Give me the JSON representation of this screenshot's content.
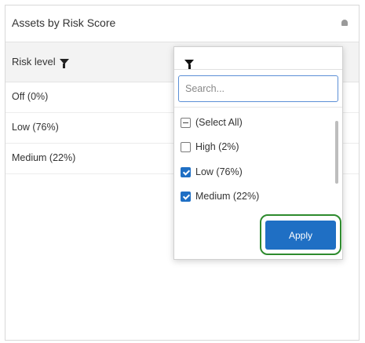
{
  "panel": {
    "title": "Assets by Risk Score"
  },
  "table": {
    "column_header": "Risk level",
    "rows": [
      "Off (0%)",
      "Low (76%)",
      "Medium (22%)"
    ]
  },
  "filter_dropdown": {
    "search_placeholder": "Search...",
    "options": [
      {
        "label": "(Select All)",
        "state": "indeterminate"
      },
      {
        "label": "High (2%)",
        "state": "unchecked"
      },
      {
        "label": "Low (76%)",
        "state": "checked"
      },
      {
        "label": "Medium (22%)",
        "state": "checked"
      }
    ],
    "apply_label": "Apply"
  },
  "colors": {
    "accent": "#1f6fc4",
    "highlight_ring": "#2e8b2e"
  }
}
